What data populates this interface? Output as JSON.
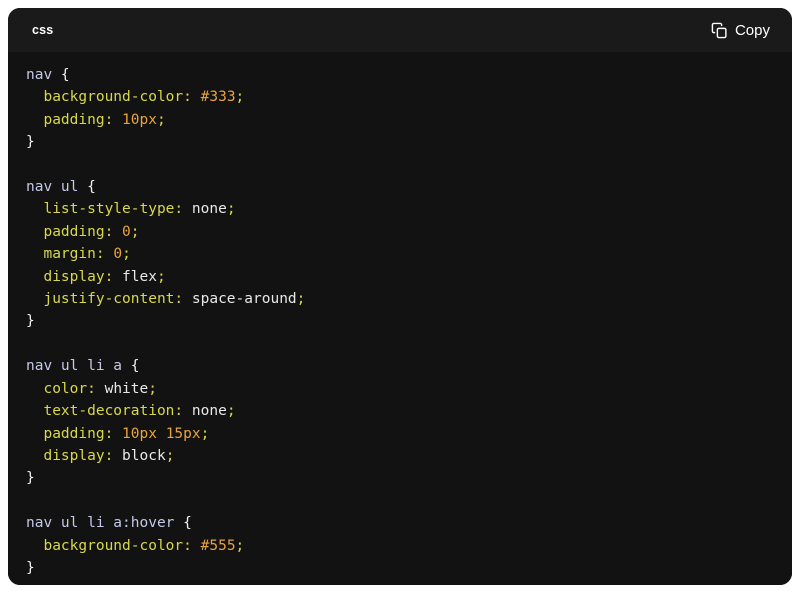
{
  "card": {
    "language_label": "css",
    "copy_button_label": "Copy",
    "copy_icon_name": "copy-icon",
    "background_color": "#121212",
    "header_background_color": "#1a1a1a",
    "page_background_color": "#ffffff"
  },
  "theme": {
    "selector_color": "#c5c8e6",
    "property_color": "#d8d84a",
    "value_color": "#e8a33d",
    "keyword_value_color": "#e8e8e8",
    "punctuation_color": "#f2f2f2"
  },
  "code": {
    "language": "css",
    "lines": [
      [
        {
          "text": "nav ",
          "type": "selector"
        },
        {
          "text": "{",
          "type": "punctuation"
        }
      ],
      [
        {
          "text": "  ",
          "type": "plain"
        },
        {
          "text": "background-color",
          "type": "property"
        },
        {
          "text": ": ",
          "type": "operator"
        },
        {
          "text": "#333",
          "type": "value"
        },
        {
          "text": ";",
          "type": "operator"
        }
      ],
      [
        {
          "text": "  ",
          "type": "plain"
        },
        {
          "text": "padding",
          "type": "property"
        },
        {
          "text": ": ",
          "type": "operator"
        },
        {
          "text": "10px",
          "type": "value"
        },
        {
          "text": ";",
          "type": "operator"
        }
      ],
      [
        {
          "text": "}",
          "type": "punctuation"
        }
      ],
      [],
      [
        {
          "text": "nav ul ",
          "type": "selector"
        },
        {
          "text": "{",
          "type": "punctuation"
        }
      ],
      [
        {
          "text": "  ",
          "type": "plain"
        },
        {
          "text": "list-style-type",
          "type": "property"
        },
        {
          "text": ": ",
          "type": "operator"
        },
        {
          "text": "none",
          "type": "keyword"
        },
        {
          "text": ";",
          "type": "operator"
        }
      ],
      [
        {
          "text": "  ",
          "type": "plain"
        },
        {
          "text": "padding",
          "type": "property"
        },
        {
          "text": ": ",
          "type": "operator"
        },
        {
          "text": "0",
          "type": "value"
        },
        {
          "text": ";",
          "type": "operator"
        }
      ],
      [
        {
          "text": "  ",
          "type": "plain"
        },
        {
          "text": "margin",
          "type": "property"
        },
        {
          "text": ": ",
          "type": "operator"
        },
        {
          "text": "0",
          "type": "value"
        },
        {
          "text": ";",
          "type": "operator"
        }
      ],
      [
        {
          "text": "  ",
          "type": "plain"
        },
        {
          "text": "display",
          "type": "property"
        },
        {
          "text": ": ",
          "type": "operator"
        },
        {
          "text": "flex",
          "type": "keyword"
        },
        {
          "text": ";",
          "type": "operator"
        }
      ],
      [
        {
          "text": "  ",
          "type": "plain"
        },
        {
          "text": "justify-content",
          "type": "property"
        },
        {
          "text": ": ",
          "type": "operator"
        },
        {
          "text": "space-around",
          "type": "keyword"
        },
        {
          "text": ";",
          "type": "operator"
        }
      ],
      [
        {
          "text": "}",
          "type": "punctuation"
        }
      ],
      [],
      [
        {
          "text": "nav ul li a ",
          "type": "selector"
        },
        {
          "text": "{",
          "type": "punctuation"
        }
      ],
      [
        {
          "text": "  ",
          "type": "plain"
        },
        {
          "text": "color",
          "type": "property"
        },
        {
          "text": ": ",
          "type": "operator"
        },
        {
          "text": "white",
          "type": "keyword"
        },
        {
          "text": ";",
          "type": "operator"
        }
      ],
      [
        {
          "text": "  ",
          "type": "plain"
        },
        {
          "text": "text-decoration",
          "type": "property"
        },
        {
          "text": ": ",
          "type": "operator"
        },
        {
          "text": "none",
          "type": "keyword"
        },
        {
          "text": ";",
          "type": "operator"
        }
      ],
      [
        {
          "text": "  ",
          "type": "plain"
        },
        {
          "text": "padding",
          "type": "property"
        },
        {
          "text": ": ",
          "type": "operator"
        },
        {
          "text": "10px 15px",
          "type": "value"
        },
        {
          "text": ";",
          "type": "operator"
        }
      ],
      [
        {
          "text": "  ",
          "type": "plain"
        },
        {
          "text": "display",
          "type": "property"
        },
        {
          "text": ": ",
          "type": "operator"
        },
        {
          "text": "block",
          "type": "keyword"
        },
        {
          "text": ";",
          "type": "operator"
        }
      ],
      [
        {
          "text": "}",
          "type": "punctuation"
        }
      ],
      [],
      [
        {
          "text": "nav ul li a:hover ",
          "type": "selector"
        },
        {
          "text": "{",
          "type": "punctuation"
        }
      ],
      [
        {
          "text": "  ",
          "type": "plain"
        },
        {
          "text": "background-color",
          "type": "property"
        },
        {
          "text": ": ",
          "type": "operator"
        },
        {
          "text": "#555",
          "type": "value"
        },
        {
          "text": ";",
          "type": "operator"
        }
      ],
      [
        {
          "text": "}",
          "type": "punctuation"
        }
      ]
    ]
  }
}
